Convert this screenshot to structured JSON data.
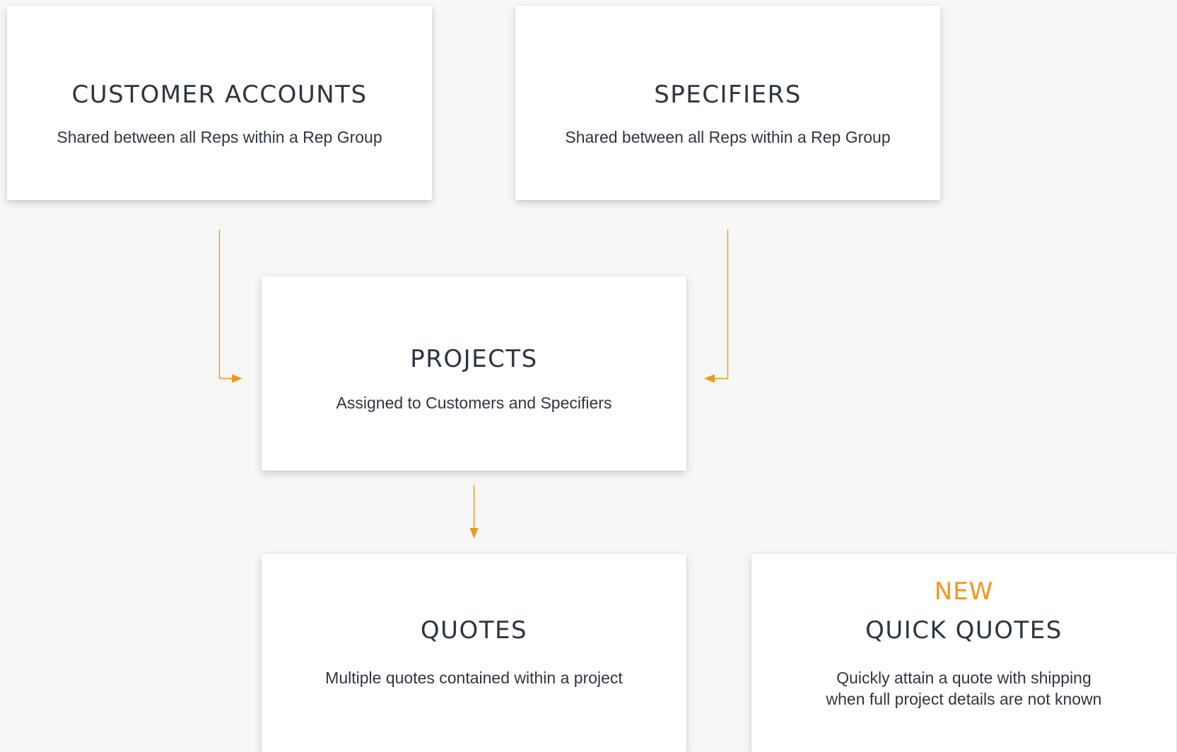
{
  "colors": {
    "background": "#f7f7f7",
    "card": "#ffffff",
    "text": "#2e3640",
    "accent": "#f0981c"
  },
  "cards": {
    "customer_accounts": {
      "title": "CUSTOMER ACCOUNTS",
      "subtitle": "Shared between all Reps within a Rep Group"
    },
    "specifiers": {
      "title": "SPECIFIERS",
      "subtitle": "Shared between all Reps within a Rep Group"
    },
    "projects": {
      "title": "PROJECTS",
      "subtitle": "Assigned to Customers and Specifiers"
    },
    "quotes": {
      "title": "QUOTES",
      "subtitle": "Multiple quotes contained within a project"
    },
    "quick_quotes": {
      "badge": "NEW",
      "title": "QUICK QUOTES",
      "subtitle_line1": "Quickly attain a quote with shipping",
      "subtitle_line2": "when full project details are not known"
    }
  },
  "connectors": [
    {
      "from": "customer_accounts",
      "to": "projects"
    },
    {
      "from": "specifiers",
      "to": "projects"
    },
    {
      "from": "projects",
      "to": "quotes"
    }
  ]
}
